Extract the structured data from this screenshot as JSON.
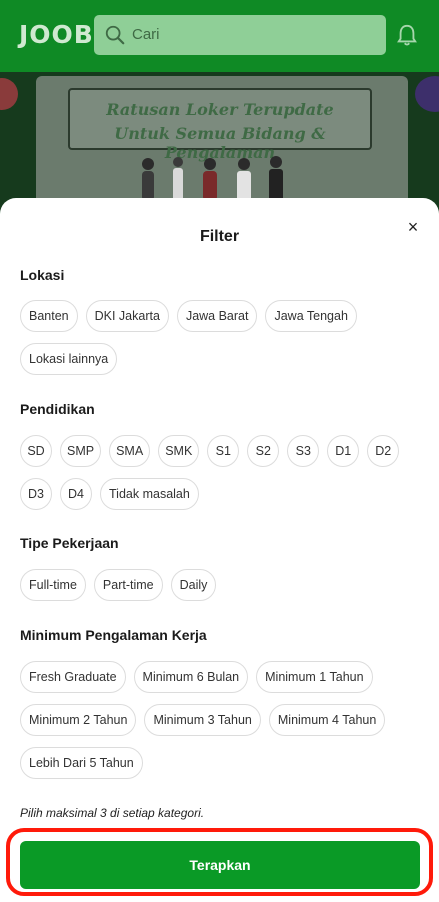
{
  "header": {
    "logo": "JOOB",
    "search_placeholder": "Cari"
  },
  "banner": {
    "line1": "Ratusan Loker Terupdate",
    "line2": "Untuk Semua Bidang & Pengalaman"
  },
  "filter": {
    "title": "Filter",
    "sections": {
      "lokasi": {
        "label": "Lokasi",
        "options": [
          "Banten",
          "DKI Jakarta",
          "Jawa Barat",
          "Jawa Tengah",
          "Lokasi lainnya"
        ]
      },
      "pendidikan": {
        "label": "Pendidikan",
        "options": [
          "SD",
          "SMP",
          "SMA",
          "SMK",
          "S1",
          "S2",
          "S3",
          "D1",
          "D2",
          "D3",
          "D4",
          "Tidak masalah"
        ]
      },
      "tipe": {
        "label": "Tipe Pekerjaan",
        "options": [
          "Full-time",
          "Part-time",
          "Daily"
        ]
      },
      "pengalaman": {
        "label": "Minimum Pengalaman Kerja",
        "options": [
          "Fresh Graduate",
          "Minimum 6 Bulan",
          "Minimum 1 Tahun",
          "Minimum 2 Tahun",
          "Minimum 3 Tahun",
          "Minimum 4 Tahun",
          "Lebih Dari 5 Tahun"
        ]
      }
    },
    "note": "Pilih maksimal 3 di setiap kategori.",
    "apply_label": "Terapkan",
    "close_symbol": "×"
  },
  "colors": {
    "brand_green": "#0a9a26",
    "highlight_red": "#ff1a0a"
  }
}
